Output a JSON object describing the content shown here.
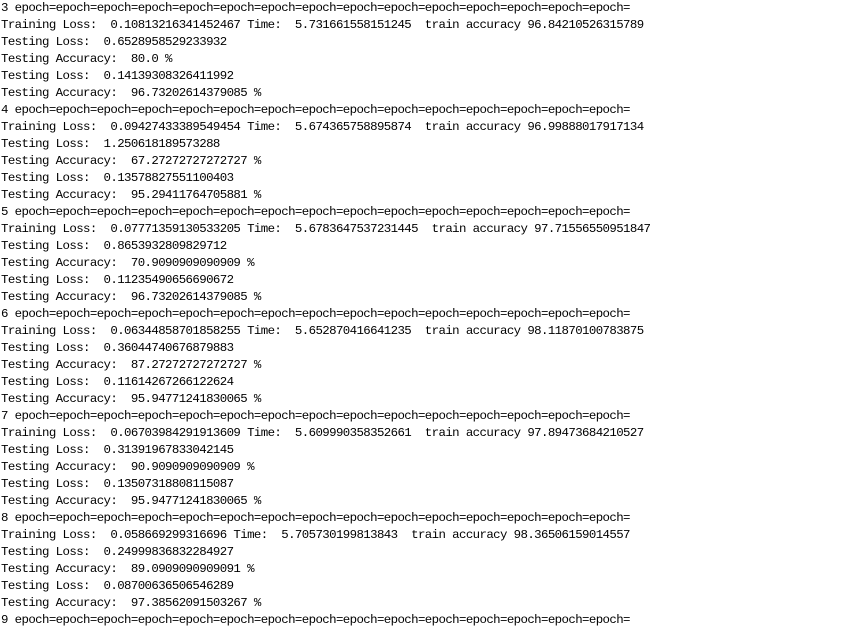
{
  "console_lines": [
    "3 epoch=epoch=epoch=epoch=epoch=epoch=epoch=epoch=epoch=epoch=epoch=epoch=epoch=epoch=epoch=",
    "Training Loss:  0.10813216341452467 Time:  5.731661558151245  train accuracy 96.84210526315789",
    "Testing Loss:  0.6528958529233932",
    "Testing Accuracy:  80.0 %",
    "Testing Loss:  0.14139308326411992",
    "Testing Accuracy:  96.73202614379085 %",
    "4 epoch=epoch=epoch=epoch=epoch=epoch=epoch=epoch=epoch=epoch=epoch=epoch=epoch=epoch=epoch=",
    "Training Loss:  0.09427433389549454 Time:  5.674365758895874  train accuracy 96.99888017917134",
    "Testing Loss:  1.250618189573288",
    "Testing Accuracy:  67.27272727272727 %",
    "Testing Loss:  0.13578827551100403",
    "Testing Accuracy:  95.29411764705881 %",
    "5 epoch=epoch=epoch=epoch=epoch=epoch=epoch=epoch=epoch=epoch=epoch=epoch=epoch=epoch=epoch=",
    "Training Loss:  0.07771359130533205 Time:  5.6783647537231445  train accuracy 97.71556550951847",
    "Testing Loss:  0.8653932809829712",
    "Testing Accuracy:  70.9090909090909 %",
    "Testing Loss:  0.11235490656690672",
    "Testing Accuracy:  96.73202614379085 %",
    "6 epoch=epoch=epoch=epoch=epoch=epoch=epoch=epoch=epoch=epoch=epoch=epoch=epoch=epoch=epoch=",
    "Training Loss:  0.06344858701858255 Time:  5.652870416641235  train accuracy 98.11870100783875",
    "Testing Loss:  0.36044740676879883",
    "Testing Accuracy:  87.27272727272727 %",
    "Testing Loss:  0.11614267266122624",
    "Testing Accuracy:  95.94771241830065 %",
    "7 epoch=epoch=epoch=epoch=epoch=epoch=epoch=epoch=epoch=epoch=epoch=epoch=epoch=epoch=epoch=",
    "Training Loss:  0.06703984291913609 Time:  5.609990358352661  train accuracy 97.89473684210527",
    "Testing Loss:  0.31391967833042145",
    "Testing Accuracy:  90.9090909090909 %",
    "Testing Loss:  0.13507318808115087",
    "Testing Accuracy:  95.94771241830065 %",
    "8 epoch=epoch=epoch=epoch=epoch=epoch=epoch=epoch=epoch=epoch=epoch=epoch=epoch=epoch=epoch=",
    "Training Loss:  0.058669299316696 Time:  5.705730199813843  train accuracy 98.36506159014557",
    "Testing Loss:  0.24999836832284927",
    "Testing Accuracy:  89.0909090909091 %",
    "Testing Loss:  0.08700636506546289",
    "Testing Accuracy:  97.38562091503267 %",
    "9 epoch=epoch=epoch=epoch=epoch=epoch=epoch=epoch=epoch=epoch=epoch=epoch=epoch=epoch=epoch="
  ]
}
